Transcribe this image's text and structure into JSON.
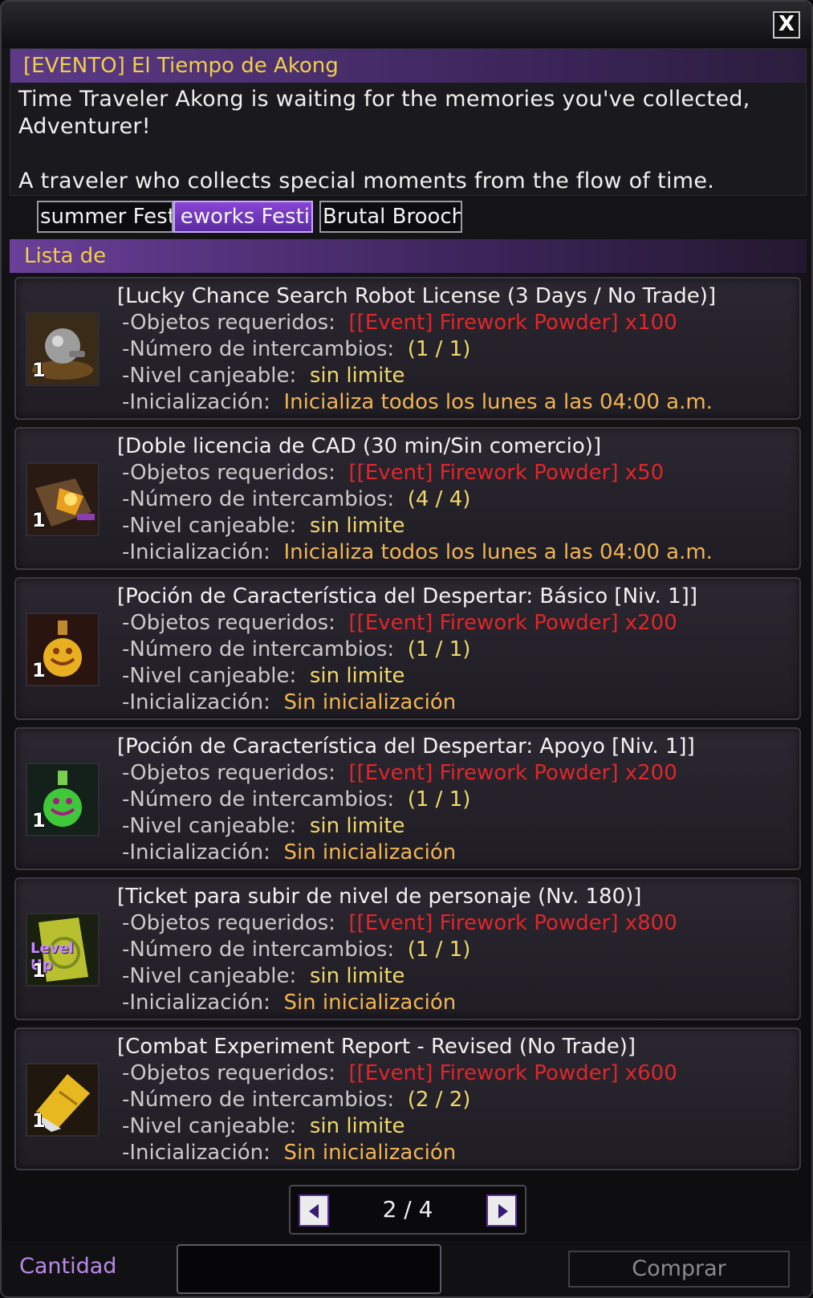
{
  "window": {
    "close_label": "X"
  },
  "event": {
    "title": "[EVENTO] El Tiempo de Akong",
    "description": "Time Traveler Akong is waiting for the memories you've collected, Adventurer!\n\nA traveler who collects special moments from the flow of time."
  },
  "tabs": [
    {
      "label": "summer Festi",
      "active": false
    },
    {
      "label": "eworks Festi",
      "active": true
    },
    {
      "label": "Brutal Brooch",
      "active": false
    }
  ],
  "list_header": "Lista de",
  "labels": {
    "required": "-Objetos requeridos:",
    "exchanges": "-Número de intercambios:",
    "level": "-Nivel canjeable:",
    "init": "-Inicialización:"
  },
  "items": [
    {
      "name": "[Lucky Chance Search Robot License (3 Days / No Trade)]",
      "qty": "1",
      "icon": "robot-license-icon",
      "required": "[[Event] Firework Powder] x100",
      "exchanges": "(1 / 1)",
      "level": "sin limite",
      "init": "Inicializa todos los lunes a las 04:00 a.m."
    },
    {
      "name": "[Doble licencia de CAD (30 min/Sin comercio)]",
      "qty": "1",
      "icon": "cad-license-icon",
      "required": "[[Event] Firework Powder] x50",
      "exchanges": "(4 / 4)",
      "level": "sin limite",
      "init": "Inicializa todos los lunes a las 04:00 a.m."
    },
    {
      "name": "[Poción de Característica del Despertar: Básico [Niv. 1]]",
      "qty": "1",
      "icon": "yellow-potion-icon",
      "required": "[[Event] Firework Powder] x200",
      "exchanges": "(1 / 1)",
      "level": "sin limite",
      "init": "Sin inicialización"
    },
    {
      "name": "[Poción de Característica del Despertar: Apoyo [Niv. 1]]",
      "qty": "1",
      "icon": "green-potion-icon",
      "required": "[[Event] Firework Powder] x200",
      "exchanges": "(1 / 1)",
      "level": "sin limite",
      "init": "Sin inicialización"
    },
    {
      "name": "[Ticket para subir de nivel de personaje (Nv. 180)]",
      "qty": "1",
      "icon": "level-up-ticket-icon",
      "icon_text": "Level Up",
      "required": "[[Event] Firework Powder] x800",
      "exchanges": "(1 / 1)",
      "level": "sin limite",
      "init": "Sin inicialización"
    },
    {
      "name": "[Combat Experiment Report - Revised (No Trade)]",
      "qty": "1",
      "icon": "experiment-report-icon",
      "required": "[[Event] Firework Powder] x600",
      "exchanges": "(2 / 2)",
      "level": "sin limite",
      "init": "Sin inicialización"
    }
  ],
  "pager": {
    "text": "2 / 4"
  },
  "footer": {
    "quantity_label": "Cantidad",
    "quantity_value": "",
    "buy_label": "Comprar"
  }
}
